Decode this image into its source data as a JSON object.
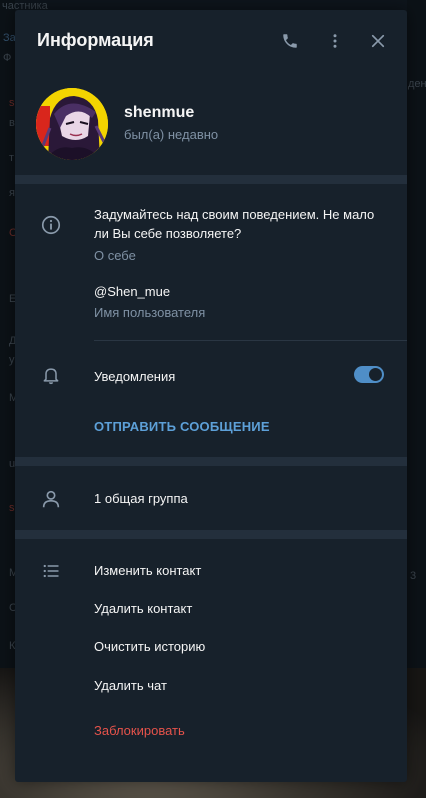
{
  "background": {
    "texts": [
      "частника",
      "За",
      "Ф",
      "s",
      "в",
      "т",
      "я",
      "С",
      "Е",
      "Д",
      "у",
      "М",
      "u",
      "s",
      "М",
      "С",
      "К",
      "дени",
      "3"
    ]
  },
  "dialog": {
    "title": "Информация",
    "icons": {
      "call": "phone-icon",
      "more": "more-vertical-icon",
      "close": "close-icon"
    }
  },
  "profile": {
    "name": "shenmue",
    "status": "был(а) недавно"
  },
  "about": {
    "bio": "Задумайтесь над своим поведением. Не мало ли Вы себе позволяете?",
    "bio_label": "О себе",
    "username": "@Shen_mue",
    "username_label": "Имя пользователя"
  },
  "notifications": {
    "label": "Уведомления",
    "enabled": true,
    "send_message": "ОТПРАВИТЬ СООБЩЕНИЕ"
  },
  "groups": {
    "label": "1 общая группа"
  },
  "actions": {
    "edit_contact": "Изменить контакт",
    "delete_contact": "Удалить контакт",
    "clear_history": "Очистить историю",
    "delete_chat": "Удалить чат",
    "block": "Заблокировать"
  },
  "colors": {
    "accent": "#5da0d8",
    "danger": "#e5534b",
    "panel": "#17212b"
  }
}
